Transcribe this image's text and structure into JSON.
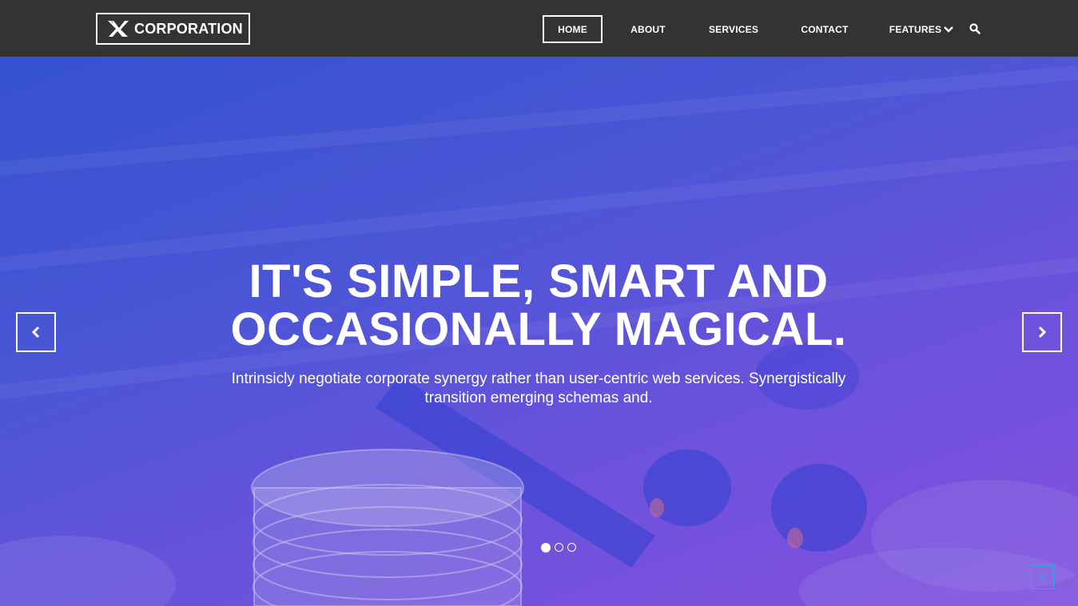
{
  "brand": {
    "name": "CORPORATION",
    "logo_icon": "x-logo-icon"
  },
  "nav": {
    "items": [
      {
        "label": "HOME",
        "active": true
      },
      {
        "label": "ABOUT",
        "active": false
      },
      {
        "label": "SERVICES",
        "active": false
      },
      {
        "label": "CONTACT",
        "active": false
      },
      {
        "label": "FEATURES",
        "active": false,
        "icon": "chevron-down-icon"
      }
    ],
    "search_icon": "search-icon"
  },
  "hero": {
    "title_line1": "IT'S SIMPLE, SMART AND",
    "title_line2": "OCCASIONALLY MAGICAL.",
    "subtitle_line1": "Intrinsicly negotiate corporate synergy rather than user-centric web services. Synergistically",
    "subtitle_line2": "transition emerging schemas and.",
    "prev_icon": "chevron-left-icon",
    "next_icon": "chevron-right-icon",
    "slides_total": 3,
    "active_slide": 1
  },
  "scroll_top_icon": "chevron-up-icon",
  "colors": {
    "navbar": "#333333",
    "hero_gradient_start": "#3552d0",
    "hero_gradient_end": "#8550de",
    "text": "#ffffff",
    "scroll_top_accent": "#3aa3e3"
  }
}
